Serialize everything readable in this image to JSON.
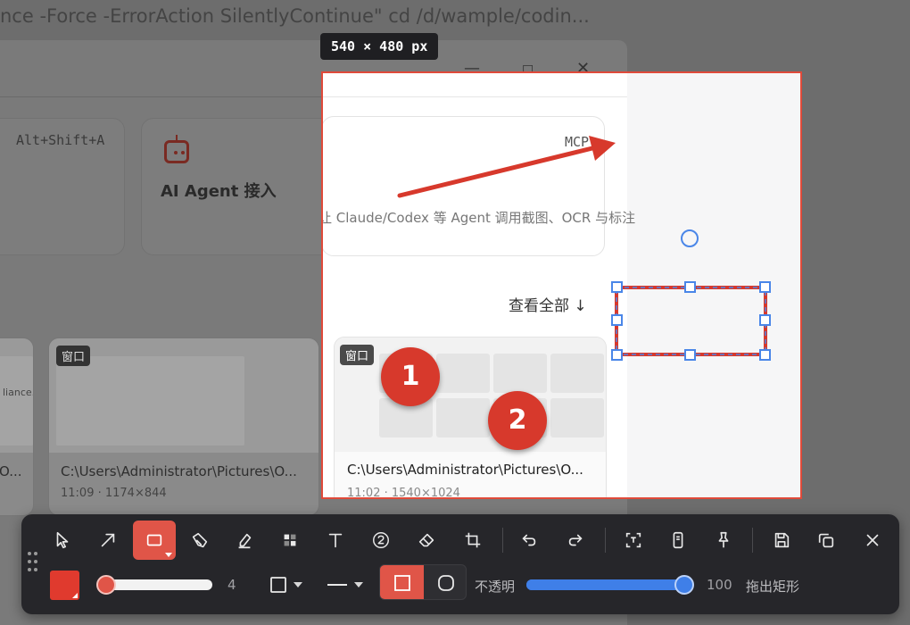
{
  "background": {
    "command_text": "nce -Force -ErrorAction SilentlyContinue\" cd /d/wample/codin...",
    "window_controls": {
      "minimize": "—",
      "maximize": "□",
      "close": "✕"
    },
    "shortcut": "Alt+Shift+A",
    "agent_card": {
      "title": "AI Agent 接入",
      "description": "让 Claude/Codex 等 Agent 调用截图、OCR 与标注",
      "badge": "MCP"
    },
    "view_all": "查看全部 ↓",
    "thumbnails": [
      {
        "tag": "",
        "path": "O...",
        "meta": "",
        "extra": "liance.ex"
      },
      {
        "tag": "窗口",
        "path": "C:\\Users\\Administrator\\Pictures\\O...",
        "meta": "11:09 · 1174×844"
      },
      {
        "tag": "窗口",
        "path": "C:\\Users\\Administrator\\Pictures\\O...",
        "meta": "11:02 · 1540×1024"
      }
    ]
  },
  "capture": {
    "size_label": "540 × 480 px"
  },
  "annotations": {
    "badges": [
      "1",
      "2"
    ],
    "accent_color": "#d7392c",
    "selection_color": "#4a86e8"
  },
  "toolbar": {
    "tools": [
      {
        "name": "select",
        "icon": "cursor-icon"
      },
      {
        "name": "arrow",
        "icon": "arrow-icon"
      },
      {
        "name": "rectangle",
        "icon": "rectangle-icon",
        "active": true
      },
      {
        "name": "pen",
        "icon": "pen-icon"
      },
      {
        "name": "highlighter",
        "icon": "highlighter-icon"
      },
      {
        "name": "mosaic",
        "icon": "mosaic-icon"
      },
      {
        "name": "text",
        "icon": "text-icon"
      },
      {
        "name": "number",
        "icon": "number-icon"
      },
      {
        "name": "eraser",
        "icon": "eraser-icon"
      },
      {
        "name": "crop",
        "icon": "crop-icon"
      },
      {
        "name": "undo",
        "icon": "undo-icon"
      },
      {
        "name": "redo",
        "icon": "redo-icon"
      },
      {
        "name": "ocr",
        "icon": "ocr-icon"
      },
      {
        "name": "long-screenshot",
        "icon": "long-screenshot-icon"
      },
      {
        "name": "pin",
        "icon": "pin-icon"
      },
      {
        "name": "save",
        "icon": "save-icon"
      },
      {
        "name": "copy",
        "icon": "copy-icon"
      },
      {
        "name": "close",
        "icon": "close-icon"
      }
    ],
    "color": "#e03a2e",
    "stroke_size": "4",
    "stroke_fraction": 0.08,
    "opacity_label": "不透明",
    "opacity_value": "100",
    "opacity_fraction": 1.0,
    "hint": "拖出矩形"
  }
}
